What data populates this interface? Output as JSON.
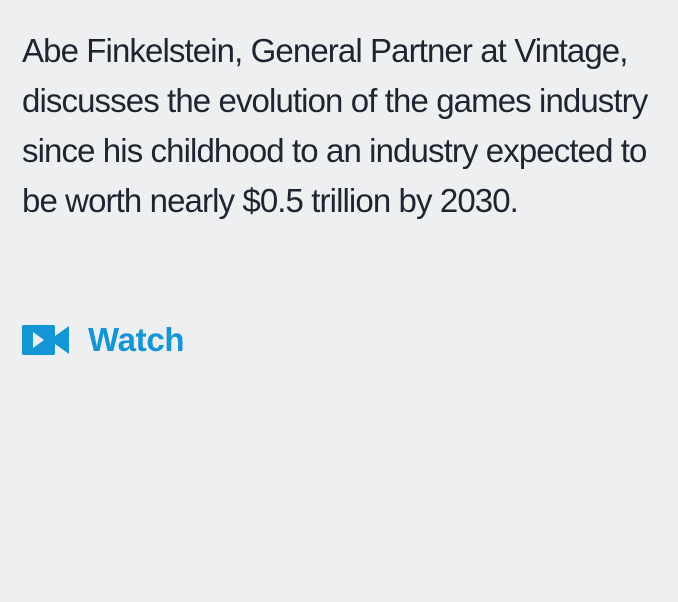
{
  "card": {
    "description": "Abe Finkelstein, General Partner at Vintage, discusses the evolution of the games industry since his childhood to an industry expected to be worth nearly $0.5 trillion by 2030.",
    "watch": {
      "label": "Watch",
      "icon": "video-camera-icon"
    }
  },
  "colors": {
    "background": "#eeeff1",
    "text": "#1f2430",
    "accent": "#1495d6"
  }
}
